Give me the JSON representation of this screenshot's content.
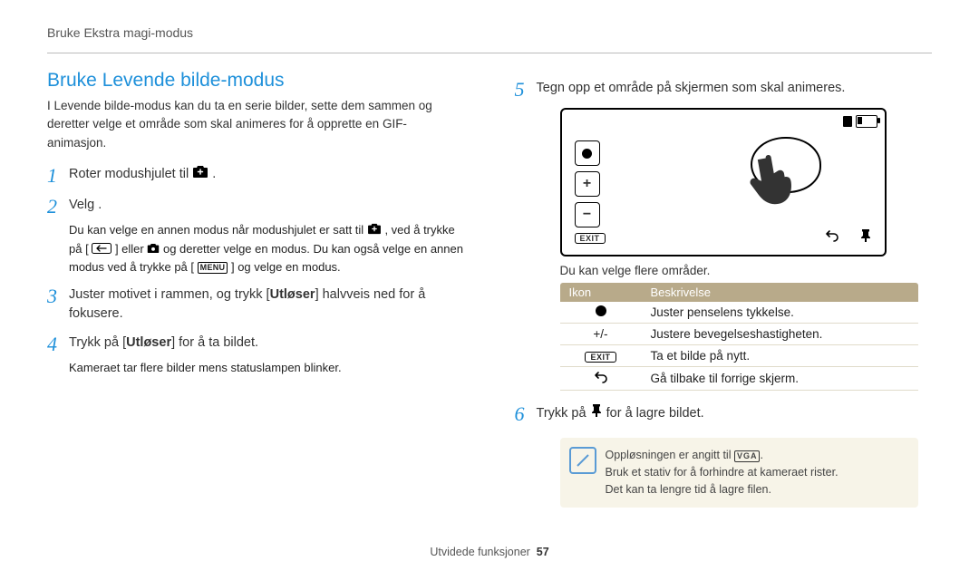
{
  "header": "Bruke Ekstra magi-modus",
  "title": "Bruke Levende bilde-modus",
  "intro": "I Levende bilde-modus kan du ta en serie bilder, sette dem sammen og deretter velge et område som skal animeres for å opprette en GIF-animasjon.",
  "steps": {
    "s1": "Roter modushjulet til ",
    "s1_end": " .",
    "s2": "Velg      .",
    "s2_sub_a": "Du kan velge en annen modus når modushjulet er satt til ",
    "s2_sub_b": " , ved å trykke på [",
    "s2_sub_c": "] eller ",
    "s2_sub_d": " og deretter velge en modus. Du kan også velge en annen modus ved å trykke på [",
    "s2_sub_e": "] og velge en modus.",
    "s3_a": "Juster motivet i rammen, og trykk [",
    "s3_b": "Utløser",
    "s3_c": "] halvveis ned for å fokusere.",
    "s4_a": "Trykk på [",
    "s4_b": "Utløser",
    "s4_c": "] for å ta bildet.",
    "s4_sub": "Kameraet tar flere bilder mens statuslampen blinker.",
    "s5": "Tegn opp et område på skjermen som skal animeres.",
    "s6_a": "Trykk på ",
    "s6_b": " for å lagre bildet."
  },
  "diagram": {
    "exit": "EXIT",
    "plus": "+",
    "minus": "−"
  },
  "caption": "Du kan velge flere områder.",
  "table": {
    "h1": "Ikon",
    "h2": "Beskrivelse",
    "rows": [
      {
        "icon": "dot",
        "desc": "Juster penselens tykkelse."
      },
      {
        "icon": "pm",
        "desc": "Justere bevegelseshastigheten."
      },
      {
        "icon": "exit",
        "desc": "Ta et bilde på nytt."
      },
      {
        "icon": "back",
        "desc": "Gå tilbake til forrige skjerm."
      }
    ]
  },
  "info": {
    "l1": "Oppløsningen er angitt til ",
    "vga": "VGA",
    "l1_end": ".",
    "l2": "Bruk et stativ for å forhindre at kameraet rister.",
    "l3": "Det kan ta lengre tid å lagre filen."
  },
  "footer_label": "Utvidede funksjoner",
  "footer_page": "57",
  "menu_label": "MENU"
}
